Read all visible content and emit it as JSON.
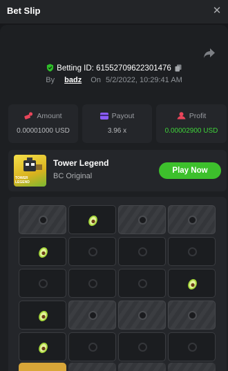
{
  "header": {
    "title": "Bet Slip",
    "close_glyph": "✕"
  },
  "bet": {
    "id_label": "Betting ID:",
    "id_value": "61552709622301476",
    "by_label": "By",
    "username": "badz",
    "on_label": "On",
    "timestamp": "5/2/2022, 10:29:41 AM"
  },
  "stats": {
    "amount": {
      "label": "Amount",
      "value": "0.00001000 USD"
    },
    "payout": {
      "label": "Payout",
      "value": "3.96 x"
    },
    "profit": {
      "label": "Profit",
      "value": "0.00002900 USD"
    }
  },
  "game": {
    "name": "Tower Legend",
    "provider": "BC Original",
    "play_label": "Play Now",
    "thumb_text_1": "TOWER",
    "thumb_text_2": "LEGEND"
  },
  "board": {
    "rows": [
      [
        "stone",
        "gem",
        "stone",
        "stone"
      ],
      [
        "gem",
        "empty",
        "empty",
        "empty"
      ],
      [
        "empty",
        "empty",
        "empty",
        "gem"
      ],
      [
        "gem",
        "stone",
        "stone",
        "stone"
      ],
      [
        "gem",
        "empty",
        "empty",
        "empty"
      ]
    ]
  },
  "colors": {
    "accent_green": "#3dc02c",
    "profit_green": "#3fd43a",
    "amount_icon": "#e8455a",
    "payout_icon": "#8b5cf6",
    "profit_icon": "#e8455a"
  }
}
